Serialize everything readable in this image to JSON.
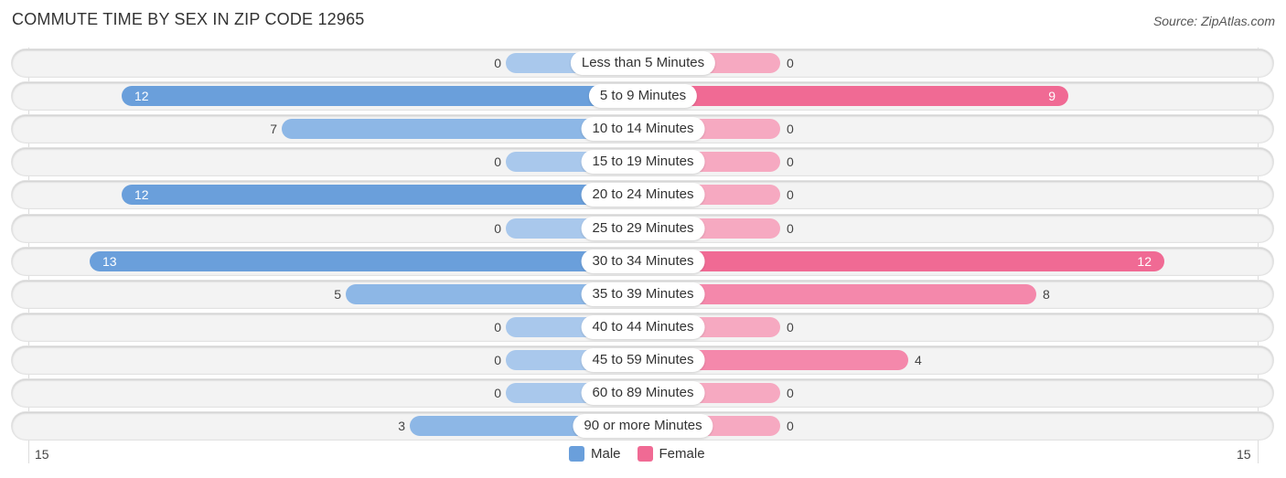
{
  "header": {
    "title": "COMMUTE TIME BY SEX IN ZIP CODE 12965",
    "source": "Source: ZipAtlas.com"
  },
  "chart_data": {
    "type": "bar",
    "orientation": "horizontal-diverging",
    "title": "COMMUTE TIME BY SEX IN ZIP CODE 12965",
    "categories": [
      "Less than 5 Minutes",
      "5 to 9 Minutes",
      "10 to 14 Minutes",
      "15 to 19 Minutes",
      "20 to 24 Minutes",
      "25 to 29 Minutes",
      "30 to 34 Minutes",
      "35 to 39 Minutes",
      "40 to 44 Minutes",
      "45 to 59 Minutes",
      "60 to 89 Minutes",
      "90 or more Minutes"
    ],
    "series": [
      {
        "name": "Male",
        "color": "#6a9fdb",
        "values": [
          0,
          12,
          7,
          0,
          12,
          0,
          13,
          5,
          0,
          0,
          0,
          3
        ]
      },
      {
        "name": "Female",
        "color": "#f06a94",
        "values": [
          0,
          9,
          0,
          0,
          0,
          0,
          12,
          8,
          0,
          4,
          0,
          0
        ]
      }
    ],
    "axis": {
      "left_label": "15",
      "right_label": "15",
      "range": [
        15,
        15
      ]
    },
    "legend": {
      "position": "bottom-center",
      "entries": [
        "Male",
        "Female"
      ]
    },
    "grid": false
  }
}
